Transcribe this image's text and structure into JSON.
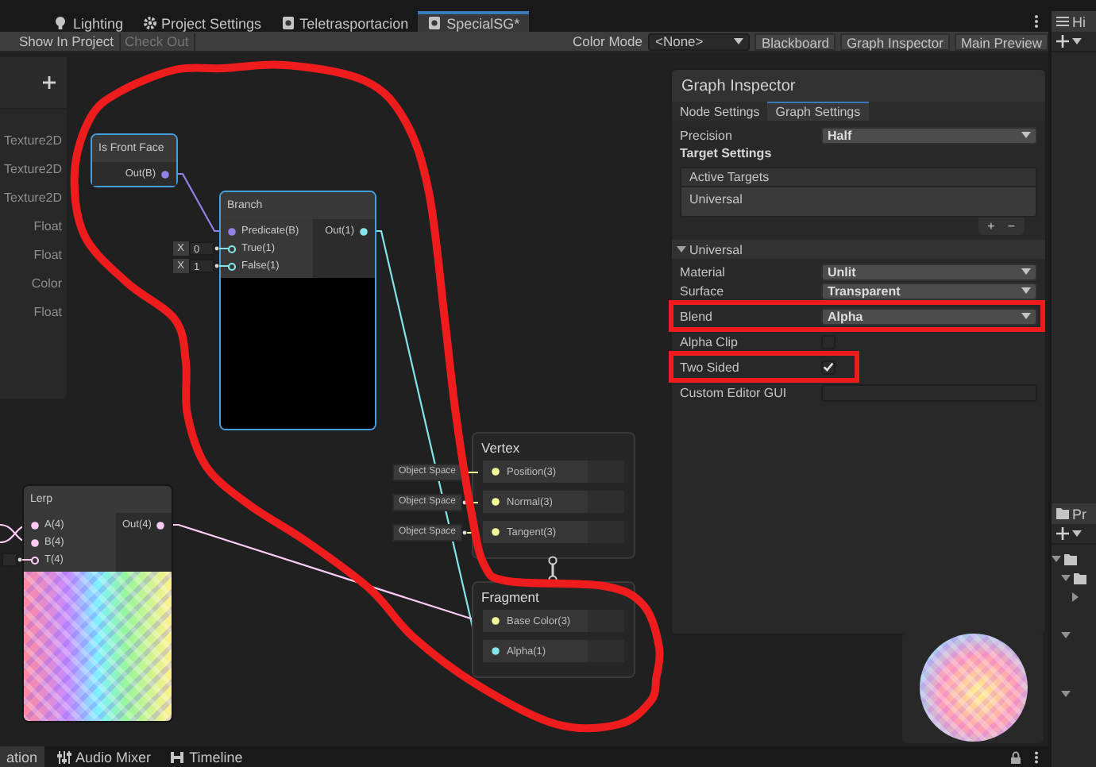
{
  "editor_tabs": [
    {
      "label": "Lighting",
      "selected": false
    },
    {
      "label": "Project Settings",
      "selected": false
    },
    {
      "label": "Teletrasportacion",
      "selected": false
    },
    {
      "label": "SpecialSG*",
      "selected": true
    }
  ],
  "toolbar": {
    "buttons": [
      {
        "label": "Show In Project",
        "disabled": false
      },
      {
        "label": "Check Out",
        "disabled": true
      }
    ],
    "color_mode": {
      "label": "Color Mode",
      "value": "<None>"
    },
    "panel_buttons": [
      "Blackboard",
      "Graph Inspector",
      "Main Preview"
    ]
  },
  "blackboard": {
    "property_types": [
      "Texture2D",
      "Texture2D",
      "Texture2D",
      "Float",
      "Float",
      "Color",
      "Float"
    ]
  },
  "nodes": [
    {
      "title": "Is Front Face",
      "kind": "no_preview",
      "selected": true,
      "outputs": [
        {
          "label": "Out(B)",
          "color": "#9481e6"
        }
      ]
    },
    {
      "title": "Branch",
      "kind": "black_preview",
      "selected": true,
      "inputs": [
        {
          "label": "Predicate(B)",
          "color": "#9481e6",
          "connected": true
        },
        {
          "label": "True(1)",
          "color": "#84e4e7",
          "connected": false,
          "axis": "X",
          "value": "0"
        },
        {
          "label": "False(1)",
          "color": "#84e4e7",
          "connected": false,
          "axis": "X",
          "value": "1"
        }
      ],
      "outputs": [
        {
          "label": "Out(1)",
          "color": "#84e4e7"
        }
      ]
    },
    {
      "title": "Lerp",
      "kind": "texture_preview",
      "selected": false,
      "inputs": [
        {
          "label": "A(4)",
          "color": "#fbcbf4",
          "connected": true
        },
        {
          "label": "B(4)",
          "color": "#fbcbf4",
          "connected": true
        },
        {
          "label": "T(4)",
          "color": "#fbcbf4",
          "connected": false
        }
      ],
      "outputs": [
        {
          "label": "Out(4)",
          "color": "#fbcbf4"
        }
      ]
    }
  ],
  "master_stack": [
    {
      "title": "Vertex",
      "ports": [
        {
          "label": "Position(3)",
          "color": "#f6ff9a",
          "space": "Object Space"
        },
        {
          "label": "Normal(3)",
          "color": "#f6ff9a",
          "space": "Object Space"
        },
        {
          "label": "Tangent(3)",
          "color": "#f6ff9a",
          "space": "Object Space"
        }
      ]
    },
    {
      "title": "Fragment",
      "ports": [
        {
          "label": "Base Color(3)",
          "color": "#f6ff9a"
        },
        {
          "label": "Alpha(1)",
          "color": "#84e4e7"
        }
      ]
    }
  ],
  "graph_inspector": {
    "title": "Graph Inspector",
    "tabs": [
      {
        "label": "Node Settings",
        "selected": false
      },
      {
        "label": "Graph Settings",
        "selected": true
      }
    ],
    "precision": {
      "label": "Precision",
      "value": "Half"
    },
    "target_settings": {
      "heading": "Target Settings",
      "list_header": "Active Targets",
      "items": [
        "Universal"
      ],
      "buttons": [
        "+",
        "−"
      ]
    },
    "section": {
      "label": "Universal",
      "expanded": true,
      "fields": [
        {
          "kind": "dropdown",
          "label": "Material",
          "value": "Unlit",
          "highlighted": false
        },
        {
          "kind": "dropdown",
          "label": "Surface",
          "value": "Transparent",
          "highlighted": false
        },
        {
          "kind": "dropdown",
          "label": "Blend",
          "value": "Alpha",
          "highlighted": true
        },
        {
          "kind": "checkbox",
          "label": "Alpha Clip",
          "checked": false,
          "highlighted": false
        },
        {
          "kind": "checkbox",
          "label": "Two Sided",
          "checked": true,
          "highlighted": true
        },
        {
          "kind": "text_field",
          "label": "Custom Editor GUI",
          "highlighted": false
        }
      ]
    }
  },
  "annotations": [
    {
      "kind": "freehand_loop"
    }
  ],
  "bottom_tabs": [
    {
      "label": "ation",
      "selected": true
    },
    {
      "label": "Audio Mixer",
      "selected": false
    },
    {
      "label": "Timeline",
      "selected": false
    }
  ],
  "side_panels": [
    {
      "kind": "hierarchy",
      "label": "Hi"
    },
    {
      "kind": "project",
      "label": "Pr"
    }
  ]
}
